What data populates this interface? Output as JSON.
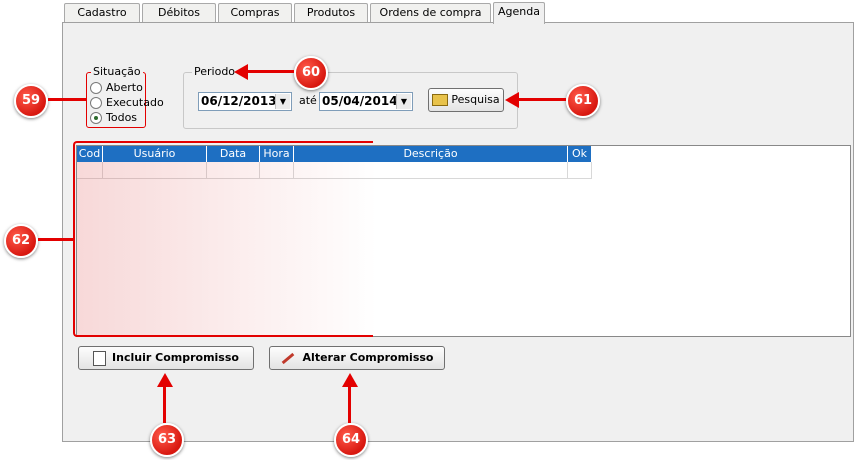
{
  "tabs": [
    {
      "label": "Cadastro",
      "active": false
    },
    {
      "label": "Débitos",
      "active": false
    },
    {
      "label": "Compras",
      "active": false
    },
    {
      "label": "Produtos",
      "active": false
    },
    {
      "label": "Ordens de compra",
      "active": false
    },
    {
      "label": "Agenda",
      "active": true
    }
  ],
  "situacao": {
    "legend": "Situação",
    "options": [
      "Aberto",
      "Executado",
      "Todos"
    ],
    "selected": "Todos"
  },
  "periodo": {
    "legend": "Periodo",
    "start_date": "06/12/2013",
    "separator": "até",
    "end_date": "05/04/2014",
    "search_label": "Pesquisa"
  },
  "grid": {
    "columns": [
      "Cod",
      "Usuário",
      "Data",
      "Hora",
      "Descrição",
      "Ok"
    ]
  },
  "buttons": {
    "include": "Incluir Compromisso",
    "alter": "Alterar Compromisso"
  },
  "callouts": [
    "59",
    "60",
    "61",
    "62",
    "63",
    "64"
  ],
  "colors": {
    "callout": "#d81810",
    "grid_header": "#1e6fc2",
    "highlight": "#e30000"
  }
}
